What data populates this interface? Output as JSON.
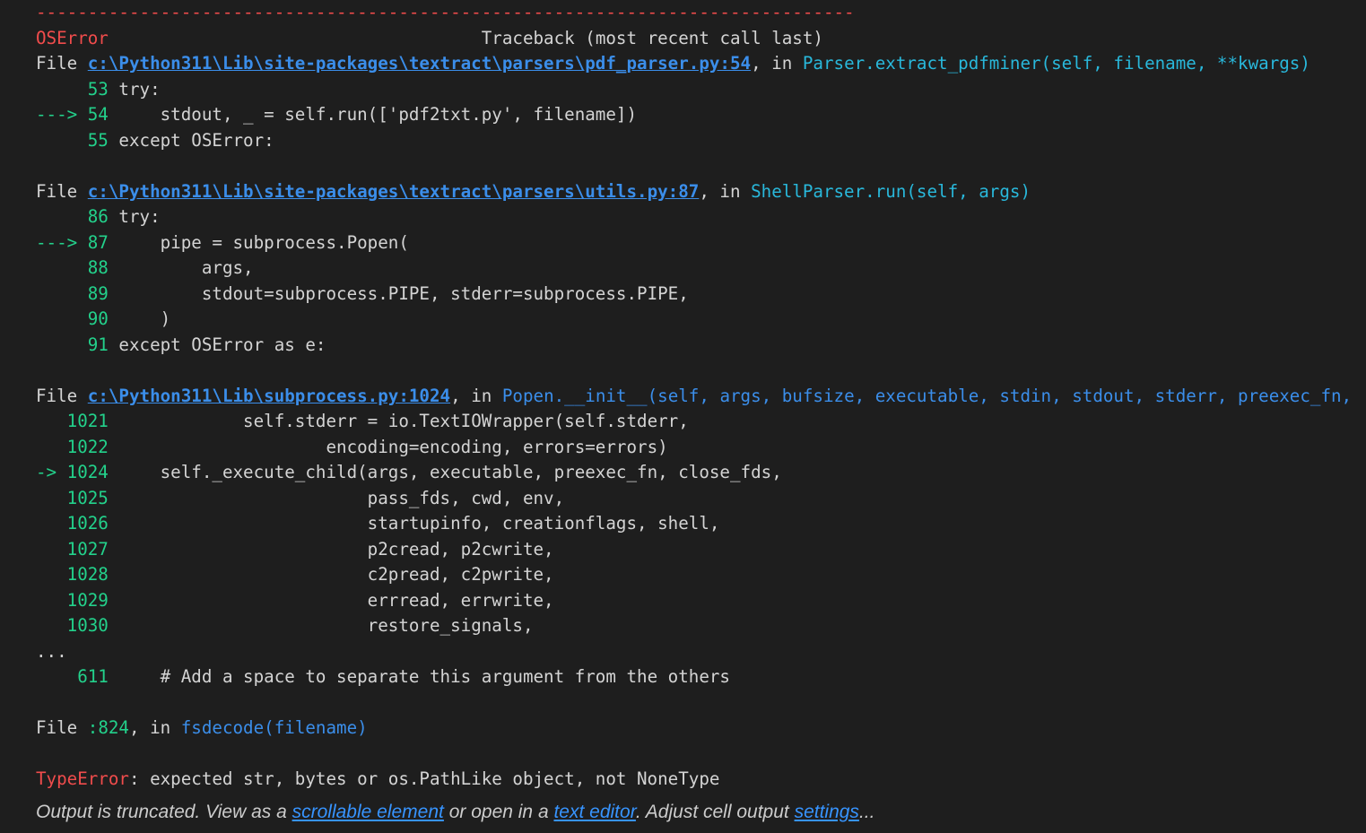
{
  "separator": "-------------------------------------------------------------------------------",
  "header": {
    "error_name": "OSError",
    "spacer": "                                    ",
    "traceback_title": "Traceback (most recent call last)"
  },
  "frame1": {
    "file_kw": "File ",
    "path": "c:\\Python311\\Lib\\site-packages\\textract\\parsers\\pdf_parser.py:54",
    "in_kw": ", in ",
    "func": "Parser.extract_pdfminer(self, filename, **kwargs)",
    "lines": [
      {
        "prefix": "     53",
        "code": " try:"
      },
      {
        "prefix": "---> 54",
        "code": "     stdout, _ = self.run(['pdf2txt.py', filename])"
      },
      {
        "prefix": "     55",
        "code": " except OSError:"
      }
    ]
  },
  "frame2": {
    "file_kw": "File ",
    "path": "c:\\Python311\\Lib\\site-packages\\textract\\parsers\\utils.py:87",
    "in_kw": ", in ",
    "func": "ShellParser.run(self, args)",
    "lines": [
      {
        "prefix": "     86",
        "code": " try:"
      },
      {
        "prefix": "---> 87",
        "code": "     pipe = subprocess.Popen("
      },
      {
        "prefix": "     88",
        "code": "         args,"
      },
      {
        "prefix": "     89",
        "code": "         stdout=subprocess.PIPE, stderr=subprocess.PIPE,"
      },
      {
        "prefix": "     90",
        "code": "     )"
      },
      {
        "prefix": "     91",
        "code": " except OSError as e:"
      }
    ]
  },
  "frame3": {
    "file_kw": "File ",
    "path": "c:\\Python311\\Lib\\subprocess.py:1024",
    "in_kw": ", in ",
    "func": "Popen.__init__(self, args, bufsize, executable, stdin, stdout, stderr, preexec_fn,",
    "lines": [
      {
        "prefix": "   1021",
        "code": "             self.stderr = io.TextIOWrapper(self.stderr,"
      },
      {
        "prefix": "   1022",
        "code": "                     encoding=encoding, errors=errors)"
      },
      {
        "prefix": "-> 1024",
        "code": "     self._execute_child(args, executable, preexec_fn, close_fds,"
      },
      {
        "prefix": "   1025",
        "code": "                         pass_fds, cwd, env,"
      },
      {
        "prefix": "   1026",
        "code": "                         startupinfo, creationflags, shell,"
      },
      {
        "prefix": "   1027",
        "code": "                         p2cread, p2cwrite,"
      },
      {
        "prefix": "   1028",
        "code": "                         c2pread, c2pwrite,"
      },
      {
        "prefix": "   1029",
        "code": "                         errread, errwrite,"
      },
      {
        "prefix": "   1030",
        "code": "                         restore_signals,"
      }
    ]
  },
  "ellipsis": "...",
  "frame4": {
    "prefix": "    611",
    "code": "     # Add a space to separate this argument from the others"
  },
  "frame5": {
    "file_kw": "File ",
    "loc": ":824",
    "in_kw": ", in ",
    "func": "fsdecode(filename)"
  },
  "final_error": {
    "name": "TypeError",
    "message": ": expected str, bytes or os.PathLike object, not NoneType"
  },
  "footer": {
    "text1": "Output is truncated. View as a ",
    "link1": "scrollable element",
    "text2": " or open in a ",
    "link2": "text editor",
    "text3": ". Adjust cell output ",
    "link3": "settings",
    "text4": "..."
  },
  "colors": {
    "background": "#1e1e1e",
    "text": "#d4d4d4",
    "error_red": "#f14c4c",
    "line_green": "#23d18b",
    "func_cyan": "#29b8db",
    "link_blue": "#3b8eea"
  }
}
